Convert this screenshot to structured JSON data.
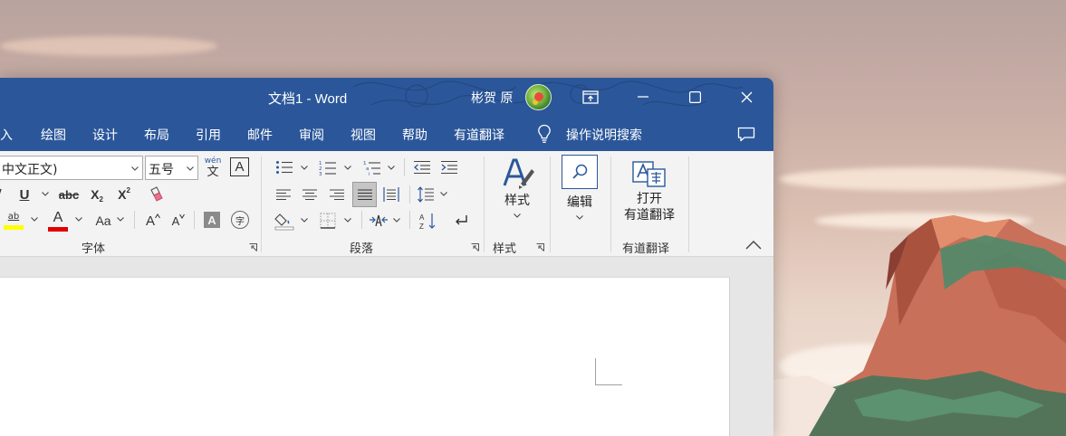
{
  "window": {
    "title": "文档1  -  Word",
    "user_name": "彬贺 原"
  },
  "tabs": [
    {
      "label": "插入"
    },
    {
      "label": "绘图"
    },
    {
      "label": "设计"
    },
    {
      "label": "布局"
    },
    {
      "label": "引用"
    },
    {
      "label": "邮件"
    },
    {
      "label": "审阅"
    },
    {
      "label": "视图"
    },
    {
      "label": "帮助"
    },
    {
      "label": "有道翻译"
    },
    {
      "label": "操作说明搜索"
    }
  ],
  "font_group": {
    "font_name": "中文正文)",
    "font_size": "五号",
    "pinyin_glyph": "wén",
    "pinyin_char": "文",
    "char_border": "A",
    "underline": "U",
    "strike": "abc",
    "subscript": "X",
    "subscript_small": "2",
    "superscript": "X",
    "superscript_small": "2",
    "highlight_glyph": "ab",
    "font_color_glyph": "A",
    "change_case": "Aa",
    "grow_font": "A",
    "shrink_font": "A",
    "char_shading": "A",
    "enclose_char": "字",
    "label": "字体"
  },
  "paragraph_group": {
    "label": "段落"
  },
  "styles_group": {
    "button_label": "样式",
    "label": "样式"
  },
  "editing_group": {
    "button_label": "编辑"
  },
  "youdao_group": {
    "button_label_line1": "打开",
    "button_label_line2": "有道翻译",
    "label": "有道翻译"
  },
  "colors": {
    "titlebar": "#2b579a",
    "highlight_yellow": "#ffff00",
    "font_red": "#e00000",
    "ribbon_bg": "#f3f3f3"
  }
}
